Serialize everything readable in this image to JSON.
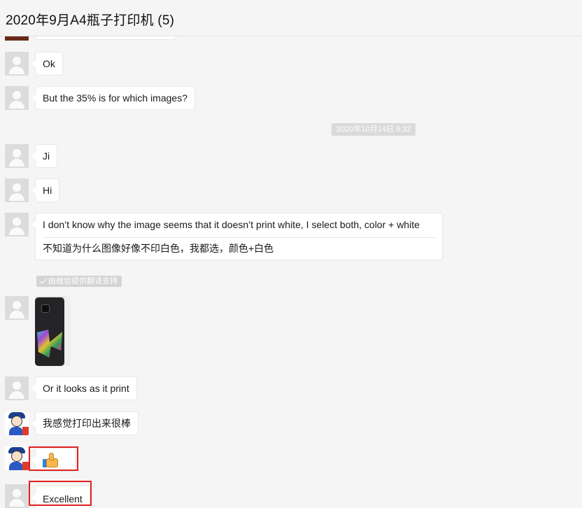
{
  "header": {
    "title": "2020年9月A4瓶子打印机 (5)"
  },
  "messages": {
    "ok": "Ok",
    "question": "But the 35% is for which images?",
    "timestamp": "2020年10月14日 9:32",
    "ji": "Ji",
    "hi": "Hi",
    "long_en": "I don’t know why the image seems that it doesn’t print white, I select both, color + white",
    "long_zh": "不知道为什么图像好像不印白色，我都选，颜色+白色",
    "translation_tag": "由微信提供翻译支持",
    "looks": "Or it looks as it print",
    "feel_good": "我感觉打印出来很棒",
    "excellent": "Excellent"
  },
  "icons": {
    "default_avatar": "person-silhouette-icon",
    "cartoon_avatar": "cartoon-avatar-icon",
    "thumbs_up": "thumbs-up-emoji-icon",
    "translate_check": "check-icon"
  },
  "colors": {
    "background": "#f5f5f5",
    "bubble": "#ffffff",
    "highlight_box": "#e02020",
    "timestamp_bg": "#dadada"
  }
}
